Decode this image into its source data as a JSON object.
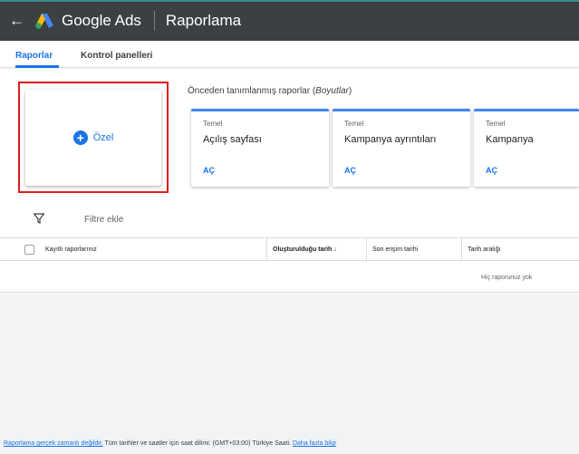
{
  "header": {
    "brand": "Google Ads",
    "page_title": "Raporlama"
  },
  "tabs": [
    {
      "label": "Raporlar",
      "active": true
    },
    {
      "label": "Kontrol panelleri",
      "active": false
    }
  ],
  "custom_report": {
    "label": "Özel"
  },
  "predefined": {
    "title_prefix": "Önceden tanımlanmış raporlar (",
    "title_emph": "Boyutlar",
    "title_suffix": ")",
    "cards": [
      {
        "category": "Temel",
        "name": "Açılış sayfası",
        "action": "AÇ"
      },
      {
        "category": "Temel",
        "name": "Kampanya ayrıntıları",
        "action": "AÇ"
      },
      {
        "category": "Temel",
        "name": "Kampanya",
        "action": "AÇ"
      }
    ]
  },
  "filter": {
    "label": "Filtre ekle"
  },
  "table": {
    "columns": [
      "Kayıtlı raporlarınız",
      "Oluşturulduğu tarih",
      "Son erişim tarihi",
      "Tarih aralığı"
    ],
    "sort_indicator": "↓",
    "empty_text": "Hiç raporunuz yok"
  },
  "footer": {
    "link1": "Raporlama gerçek zamanlı değildir.",
    "text": " Tüm tarihler ve saatler için saat dilimi: (GMT+03:00) Türkiye Saati. ",
    "link2": "Daha fazla bilgi"
  },
  "colors": {
    "topbar": "#3c4043",
    "accent_blue": "#1a73e8",
    "highlight_red": "#e01b1b"
  }
}
